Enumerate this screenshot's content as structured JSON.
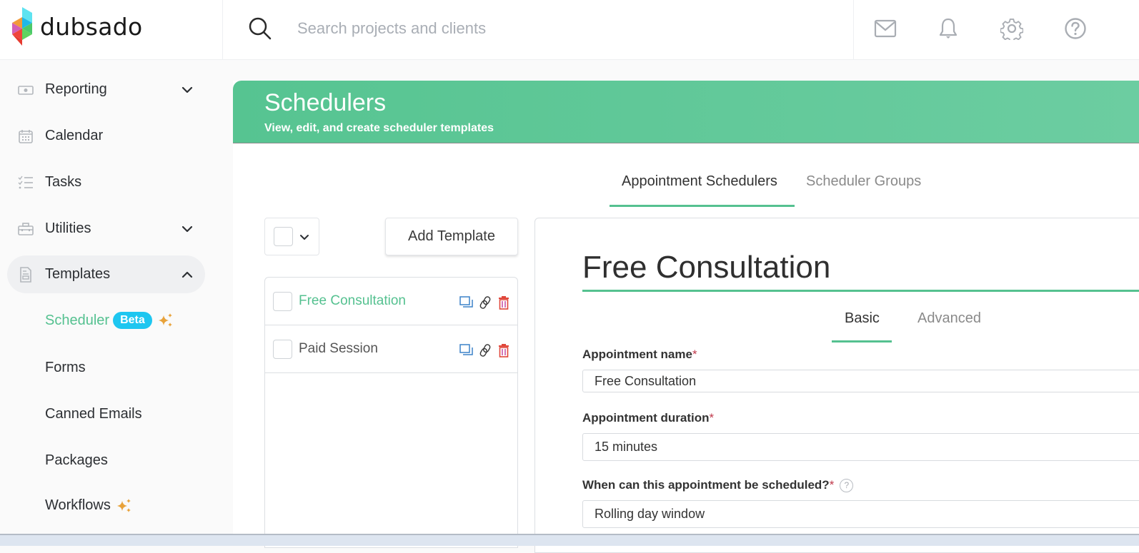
{
  "app": {
    "brand": "dubsado"
  },
  "search": {
    "placeholder": "Search projects and clients"
  },
  "top_icons": [
    "mail-icon",
    "bell-icon",
    "gear-icon",
    "help-icon"
  ],
  "sidebar": {
    "items": [
      {
        "label": "Reporting",
        "icon": "money-icon",
        "chevron": "down"
      },
      {
        "label": "Calendar",
        "icon": "calendar-icon"
      },
      {
        "label": "Tasks",
        "icon": "checklist-icon"
      },
      {
        "label": "Utilities",
        "icon": "toolbox-icon",
        "chevron": "down"
      },
      {
        "label": "Templates",
        "icon": "document-icon",
        "chevron": "up",
        "active": true
      }
    ],
    "sub_items": [
      {
        "label": "Scheduler",
        "badge": "Beta",
        "sparkle": true,
        "active": true
      },
      {
        "label": "Forms"
      },
      {
        "label": "Canned Emails"
      },
      {
        "label": "Packages"
      },
      {
        "label": "Workflows",
        "sparkle": true
      }
    ]
  },
  "banner": {
    "title": "Schedulers",
    "subtitle": "View, edit, and create scheduler templates"
  },
  "tabs": [
    {
      "label": "Appointment Schedulers",
      "active": true
    },
    {
      "label": "Scheduler Groups",
      "active": false
    }
  ],
  "toolbar": {
    "add_template_label": "Add Template"
  },
  "templates": [
    {
      "name": "Free Consultation",
      "selected": true
    },
    {
      "name": "Paid Session",
      "selected": false
    }
  ],
  "editor": {
    "title": "Free Consultation",
    "tabs": [
      {
        "label": "Basic",
        "active": true
      },
      {
        "label": "Advanced",
        "active": false
      }
    ],
    "fields": [
      {
        "label": "Appointment name",
        "required_mark": "*",
        "value": "Free Consultation"
      },
      {
        "label": "Appointment duration",
        "required_mark": "*",
        "value": "15 minutes"
      },
      {
        "label": "When can this appointment be scheduled?",
        "required_mark": "*",
        "help": "?",
        "value": "Rolling day window"
      }
    ]
  },
  "colors": {
    "accent_green": "#55c190",
    "beta_blue": "#1ec6f0",
    "sparkle_orange": "#e8a23a",
    "duplicate_blue": "#3b82c8",
    "delete_red": "#e0463a"
  }
}
